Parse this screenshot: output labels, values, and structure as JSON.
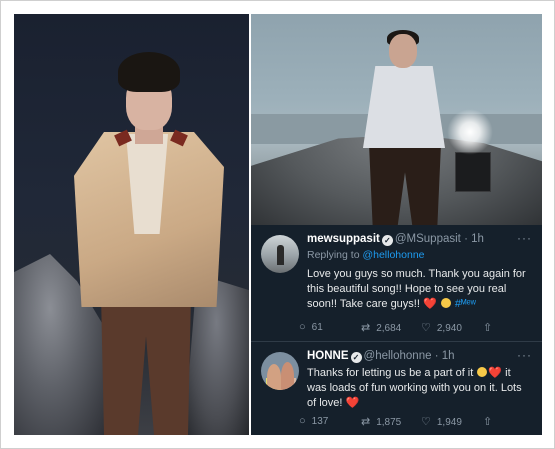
{
  "tweets": [
    {
      "name": "mewsuppasit",
      "handle": "@MSuppasit",
      "time": "· 1h",
      "reply_prefix": "Replying to ",
      "reply_to": "@hellohonne",
      "text_1": "Love you guys so much. Thank you again for this beautiful song!! Hope to see you real soon!! Take care guys!! ",
      "emoji_1": "❤️",
      "hashtag": "#ᴹᵉʷ",
      "replies": "61",
      "retweets": "2,684",
      "likes": "2,940"
    },
    {
      "name": "HONNE",
      "handle": "@hellohonne",
      "time": "· 1h",
      "text_1": "Thanks for letting us be a part of it ",
      "emoji_1": "❤️",
      "text_2": " it was loads of fun working with you on it. Lots of love! ",
      "emoji_2": "❤️",
      "replies": "137",
      "retweets": "1,875",
      "likes": "1,949"
    }
  ],
  "icons": {
    "more": "···",
    "verified": "✓",
    "reply": "○",
    "retweet": "⇄",
    "like": "♡",
    "share": "⇧"
  },
  "colors": {
    "tweet_bg": "#15202b",
    "link": "#1d9bf0",
    "heart": "#f4212e"
  }
}
